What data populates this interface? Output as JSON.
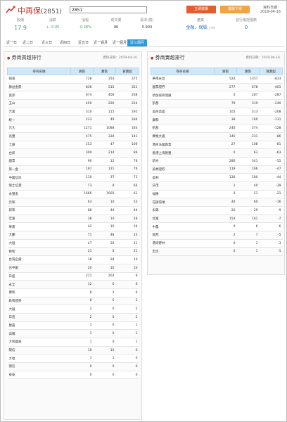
{
  "header": {
    "title": "中再保",
    "code": "(2851)",
    "search_value": "2851",
    "buy_button": "立即搶購",
    "sell_button": "模擬下單",
    "date_label": "資料日期：",
    "date": "2019-04-16"
  },
  "stats": [
    {
      "label": "股價",
      "value": "17.9"
    },
    {
      "label": "漲跌",
      "value": "↓ -0.05"
    },
    {
      "label": "漲幅",
      "value": "-0.28%"
    },
    {
      "label": "成交量",
      "value": "96"
    },
    {
      "label": "股本(億)",
      "value": "5.904"
    },
    {
      "label": "產業",
      "value": "金融．保險",
      "suffix": "(上市)"
    },
    {
      "label": "發行權證檔數",
      "value": "0"
    }
  ],
  "tabs": [
    "近一日",
    "近二日",
    "近三日",
    "近四日",
    "近五日",
    "近一週月",
    "近一個月",
    "近三個月"
  ],
  "active_tab": 7,
  "left_panel": {
    "title": "券商買超排行",
    "date": "資料日期：2019-04-16",
    "columns": [
      "券商名稱",
      "買張",
      "賣張",
      "買賣超"
    ],
    "rows": [
      [
        "凱基",
        "728",
        "353",
        "375"
      ],
      [
        "群益金鼎",
        "836",
        "515",
        "321"
      ],
      [
        "富邦",
        "674",
        "406",
        "268"
      ],
      [
        "玉山",
        "450",
        "226",
        "224"
      ],
      [
        "元富",
        "310",
        "115",
        "195"
      ],
      [
        "統一",
        "233",
        "49",
        "184"
      ],
      [
        "元大",
        "1271",
        "1088",
        "183"
      ],
      [
        "兆豐",
        "475",
        "334",
        "141"
      ],
      [
        "土銀",
        "153",
        "47",
        "106"
      ],
      [
        "台新",
        "300",
        "214",
        "86"
      ],
      [
        "國票",
        "90",
        "12",
        "78"
      ],
      [
        "第一金",
        "197",
        "121",
        "76"
      ],
      [
        "中國信託",
        "110",
        "37",
        "73"
      ],
      [
        "瑞士信貸",
        "73",
        "9",
        "64"
      ],
      [
        "永豐金",
        "1666",
        "1605",
        "61"
      ],
      [
        "元和",
        "63",
        "10",
        "53"
      ],
      [
        "新和",
        "88",
        "44",
        "44"
      ],
      [
        "宏遠",
        "38",
        "10",
        "28"
      ],
      [
        "華南",
        "42",
        "16",
        "26"
      ],
      [
        "大慶",
        "71",
        "48",
        "23"
      ],
      [
        "大展",
        "47",
        "26",
        "21"
      ],
      [
        "致和",
        "21",
        "0",
        "21"
      ],
      [
        "台灣企銀",
        "38",
        "28",
        "10"
      ],
      [
        "台中銀",
        "20",
        "10",
        "10"
      ],
      [
        "日盛",
        "211",
        "202",
        "9"
      ],
      [
        "永全",
        "12",
        "6",
        "6"
      ],
      [
        "康和",
        "8",
        "2",
        "6"
      ],
      [
        "犇和證券",
        "8",
        "5",
        "3"
      ],
      [
        "大展",
        "2",
        "0",
        "2"
      ],
      [
        "日進",
        "2",
        "0",
        "2"
      ],
      [
        "豐農",
        "1",
        "0",
        "1"
      ],
      [
        "高橋",
        "1",
        "0",
        "1"
      ],
      [
        "大和國泰",
        "1",
        "0",
        "1"
      ],
      [
        "陽信",
        "10",
        "10",
        "0"
      ],
      [
        "大福",
        "1",
        "1",
        "0"
      ],
      [
        "德信",
        "0",
        "0",
        "0"
      ],
      [
        "安泰",
        "0",
        "0",
        "0"
      ]
    ]
  },
  "right_panel": {
    "title": "券商賣超排行",
    "date": "資料日期：2019-04-16",
    "columns": [
      "券商名稱",
      "買張",
      "賣張",
      "買賣超"
    ],
    "rows": [
      [
        "華南永昌",
        "524",
        "1357",
        "-833"
      ],
      [
        "國票證券",
        "277",
        "678",
        "-401"
      ],
      [
        "新加坡商瑞銀",
        "0",
        "287",
        "-287"
      ],
      [
        "凱基",
        "79",
        "319",
        "-240"
      ],
      [
        "美商高盛",
        "105",
        "313",
        "-208"
      ],
      [
        "康和",
        "38",
        "169",
        "-131"
      ],
      [
        "凱基",
        "246",
        "374",
        "-128"
      ],
      [
        "摩根大通",
        "145",
        "231",
        "-86"
      ],
      [
        "港商法國興業",
        "27",
        "108",
        "-81"
      ],
      [
        "香港上海匯豐",
        "0",
        "63",
        "-63"
      ],
      [
        "新光",
        "286",
        "341",
        "-55"
      ],
      [
        "美林證券",
        "119",
        "166",
        "-47"
      ],
      [
        "美林",
        "136",
        "180",
        "-44"
      ],
      [
        "日茂",
        "1",
        "40",
        "-39"
      ],
      [
        "福勝",
        "0",
        "21",
        "-21"
      ],
      [
        "花旗環球",
        "44",
        "60",
        "-16"
      ],
      [
        "永興",
        "20",
        "29",
        "-9"
      ],
      [
        "合富",
        "154",
        "161",
        "-7"
      ],
      [
        "中農",
        "0",
        "6",
        "-6"
      ],
      [
        "福邦",
        "2",
        "7",
        "-5"
      ],
      [
        "港商野村",
        "0",
        "3",
        "-3"
      ],
      [
        "宏佳",
        "0",
        "1",
        "-1"
      ]
    ]
  }
}
